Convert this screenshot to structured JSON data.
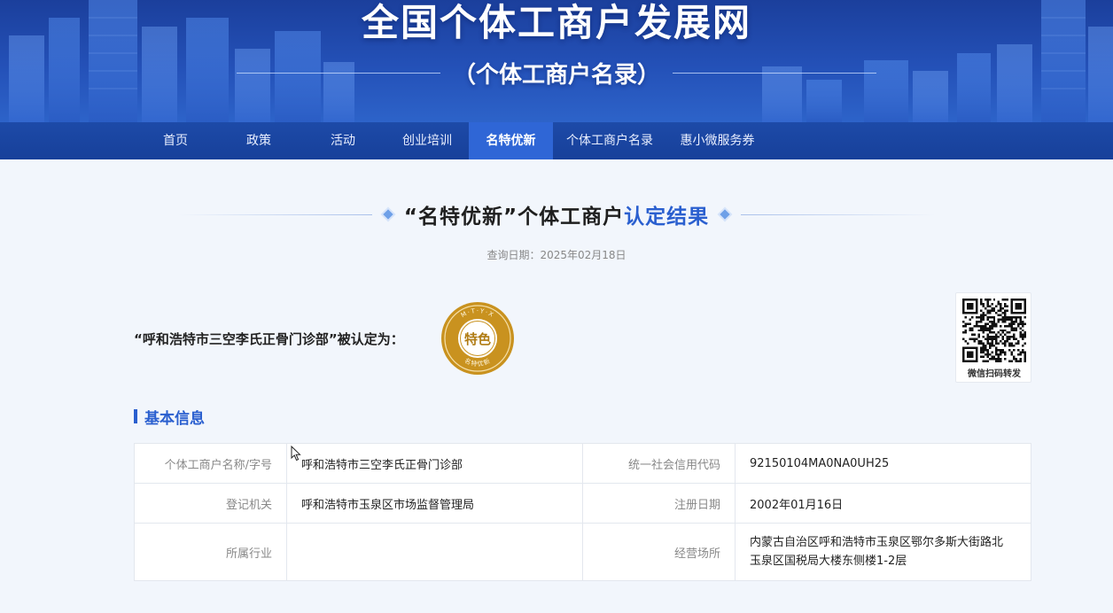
{
  "banner": {
    "title": "全国个体工商户发展网",
    "subtitle": "（个体工商户名录）"
  },
  "nav": {
    "items": [
      {
        "label": "首页",
        "active": false
      },
      {
        "label": "政策",
        "active": false
      },
      {
        "label": "活动",
        "active": false
      },
      {
        "label": "创业培训",
        "active": false
      },
      {
        "label": "名特优新",
        "active": true
      },
      {
        "label": "个体工商户名录",
        "active": false
      },
      {
        "label": "惠小微服务券",
        "active": false
      }
    ]
  },
  "result": {
    "heading_prefix": "“名特优新”个体工商户",
    "heading_highlight": "认定结果",
    "query_date": "查询日期：2025年02月18日",
    "certified_text": "“呼和浩特市三空李氏正骨门诊部”被认定为：",
    "seal": {
      "top_text": "M·T·Y·X",
      "center_text": "特色",
      "bottom_text": "名特优新",
      "color": "#c9921f"
    },
    "qr_caption": "微信扫码转发"
  },
  "basic_info": {
    "title": "基本信息",
    "rows": [
      {
        "label1": "个体工商户名称/字号",
        "value1": "呼和浩特市三空李氏正骨门诊部",
        "label2": "统一社会信用代码",
        "value2": "92150104MA0NA0UH25"
      },
      {
        "label1": "登记机关",
        "value1": "呼和浩特市玉泉区市场监督管理局",
        "label2": "注册日期",
        "value2": "2002年01月16日"
      },
      {
        "label1": "所属行业",
        "value1": "",
        "label2": "经营场所",
        "value2_line1": "内蒙古自治区呼和浩特市玉泉区鄂尔多斯大街路北",
        "value2_line2": "玉泉区国税局大楼东侧楼1-2层"
      }
    ]
  },
  "colors": {
    "accent": "#2a5fcf",
    "nav_bg": "#17409a",
    "nav_active": "#2f66d6",
    "banner_top": "#1b3f9c"
  }
}
